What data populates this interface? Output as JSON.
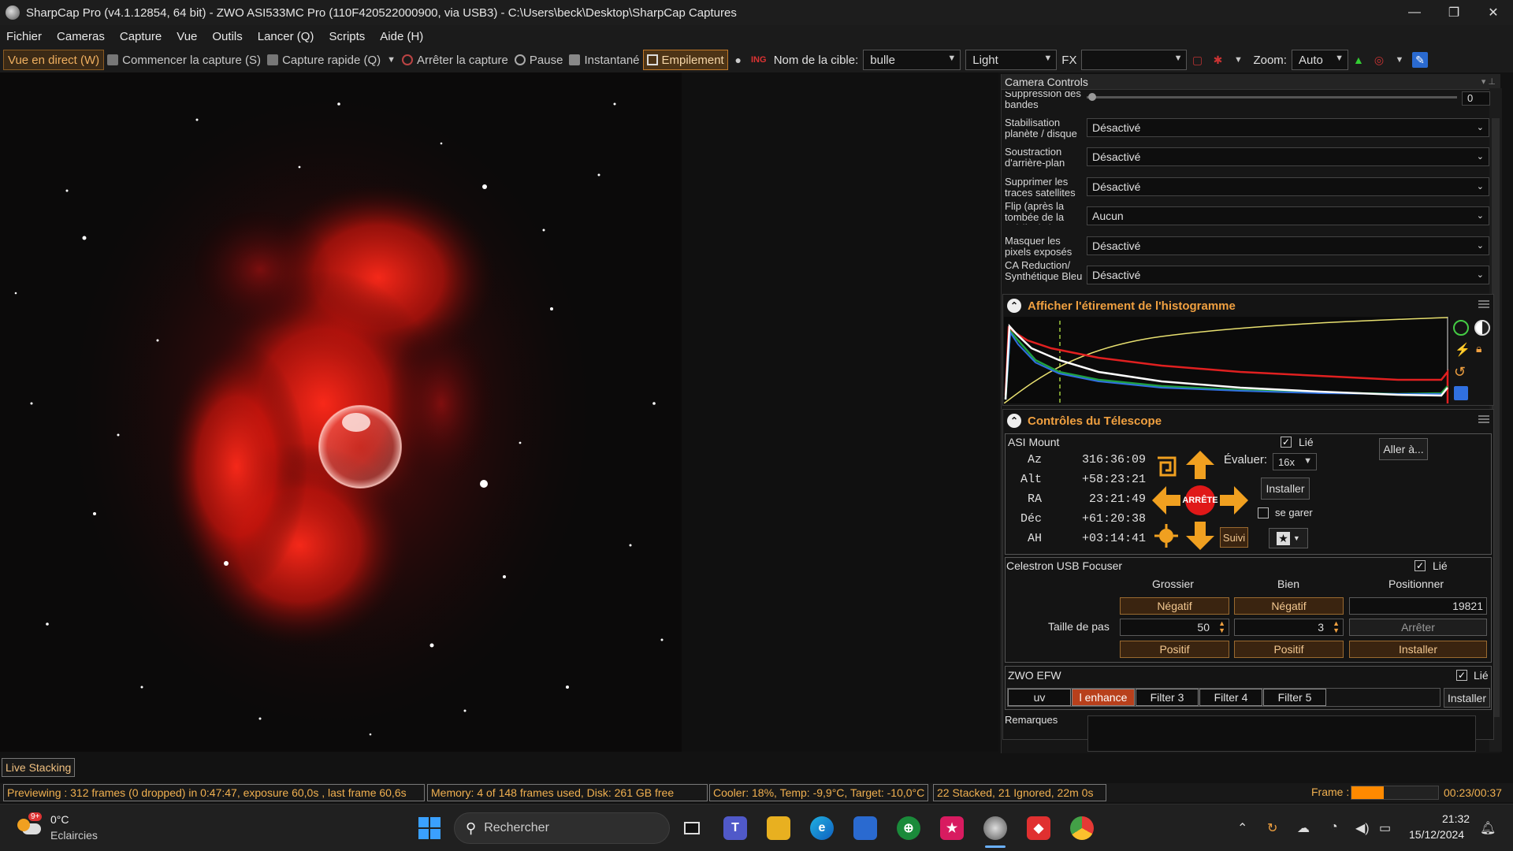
{
  "window": {
    "title": "SharpCap Pro (v4.1.12854, 64 bit) - ZWO ASI533MC Pro (110F420522000900, via USB3) - C:\\Users\\beck\\Desktop\\SharpCap Captures",
    "minimize": "—",
    "maximize": "❐",
    "close": "✕"
  },
  "menu": [
    "Fichier",
    "Cameras",
    "Capture",
    "Vue",
    "Outils",
    "Lancer (Q)",
    "Scripts",
    "Aide (H)"
  ],
  "toolbar": {
    "live": "Vue en direct (W)",
    "start_capture": "Commencer la capture (S)",
    "quick_capture": "Capture rapide (Q)",
    "stop_capture": "Arrêter la capture",
    "pause": "Pause",
    "snapshot": "Instantané",
    "stacking": "Empilement",
    "target_label": "Nom de la cible:",
    "target_value": "bulle",
    "frame_type": "Light",
    "fx_label": "FX",
    "fx_value": "",
    "zoom_label": "Zoom:",
    "zoom_value": "Auto"
  },
  "camera_controls": {
    "header": "Camera Controls",
    "banding_label": "Suppression des bandes",
    "banding_value": "0",
    "rows": [
      {
        "label": "Stabilisation planète / disque",
        "value": "Désactivé"
      },
      {
        "label": "Soustraction d'arrière-plan",
        "value": "Désactivé"
      },
      {
        "label": "Supprimer les traces satellites",
        "value": "Désactivé"
      },
      {
        "label": "Flip (après la tombée de la nuit/à plat)",
        "value": "Aucun"
      },
      {
        "label": "Masquer les pixels exposés",
        "value": "Désactivé"
      },
      {
        "label": "CA Reduction/ Synthétique Bleu",
        "value": "Désactivé"
      }
    ]
  },
  "histogram": {
    "title": "Afficher l'étirement de l'histogramme"
  },
  "telescope": {
    "title": "Contrôles du Télescope",
    "mount_name": "ASI Mount",
    "linked_label": "Lié",
    "goto": "Aller à...",
    "rate_label": "Évaluer:",
    "rate_value": "16x",
    "install": "Installer",
    "park": "se garer",
    "stop": "ARRÊTE",
    "track": "Suivi",
    "coords": [
      {
        "k": "Az",
        "v": "316:36:09"
      },
      {
        "k": "Alt",
        "v": "+58:23:21"
      },
      {
        "k": "RA",
        "v": "23:21:49"
      },
      {
        "k": "Déc",
        "v": "+61:20:38"
      },
      {
        "k": "AH",
        "v": "+03:14:41"
      }
    ]
  },
  "focuser": {
    "name": "Celestron USB Focuser",
    "linked_label": "Lié",
    "col_coarse": "Grossier",
    "col_fine": "Bien",
    "col_position": "Positionner",
    "negative": "Négatif",
    "positive": "Positif",
    "position": "19821",
    "step_label": "Taille de pas",
    "step_coarse": "50",
    "step_fine": "3",
    "stop": "Arrêter",
    "install": "Installer"
  },
  "efw": {
    "name": "ZWO EFW",
    "linked_label": "Lié",
    "filters": [
      "uv",
      "l enhance",
      "Filter 3",
      "Filter 4",
      "Filter 5"
    ],
    "install": "Installer"
  },
  "notes_label": "Remarques",
  "live_stacking_tab": "Live Stacking",
  "status": {
    "preview": "Previewing : 312 frames (0 dropped) in 0:47:47, exposure 60,0s , last frame 60,6s",
    "memory": "Memory: 4 of 148 frames used, Disk: 261 GB free",
    "cooler": "Cooler: 18%, Temp: -9,9°C, Target: -10,0°C",
    "stacked": "22 Stacked, 21 Ignored, 22m 0s",
    "frame_label": "Frame :",
    "frame_progress": 0.37,
    "time": "00:23/00:37"
  },
  "taskbar": {
    "weather_temp": "0°C",
    "weather_desc": "Eclaircies",
    "weather_badge": "9+",
    "search_placeholder": "Rechercher",
    "clock_time": "21:32",
    "clock_date": "15/12/2024"
  },
  "colors": {
    "accent": "#f0a040",
    "stack_active": "#c07828",
    "status_text": "#f0b050",
    "progress": "#ff8a00",
    "hist_red": "#e02020",
    "hist_green": "#20a040",
    "hist_blue": "#3070e0",
    "hist_white": "#ffffff",
    "hist_curve": "#e8e070"
  }
}
